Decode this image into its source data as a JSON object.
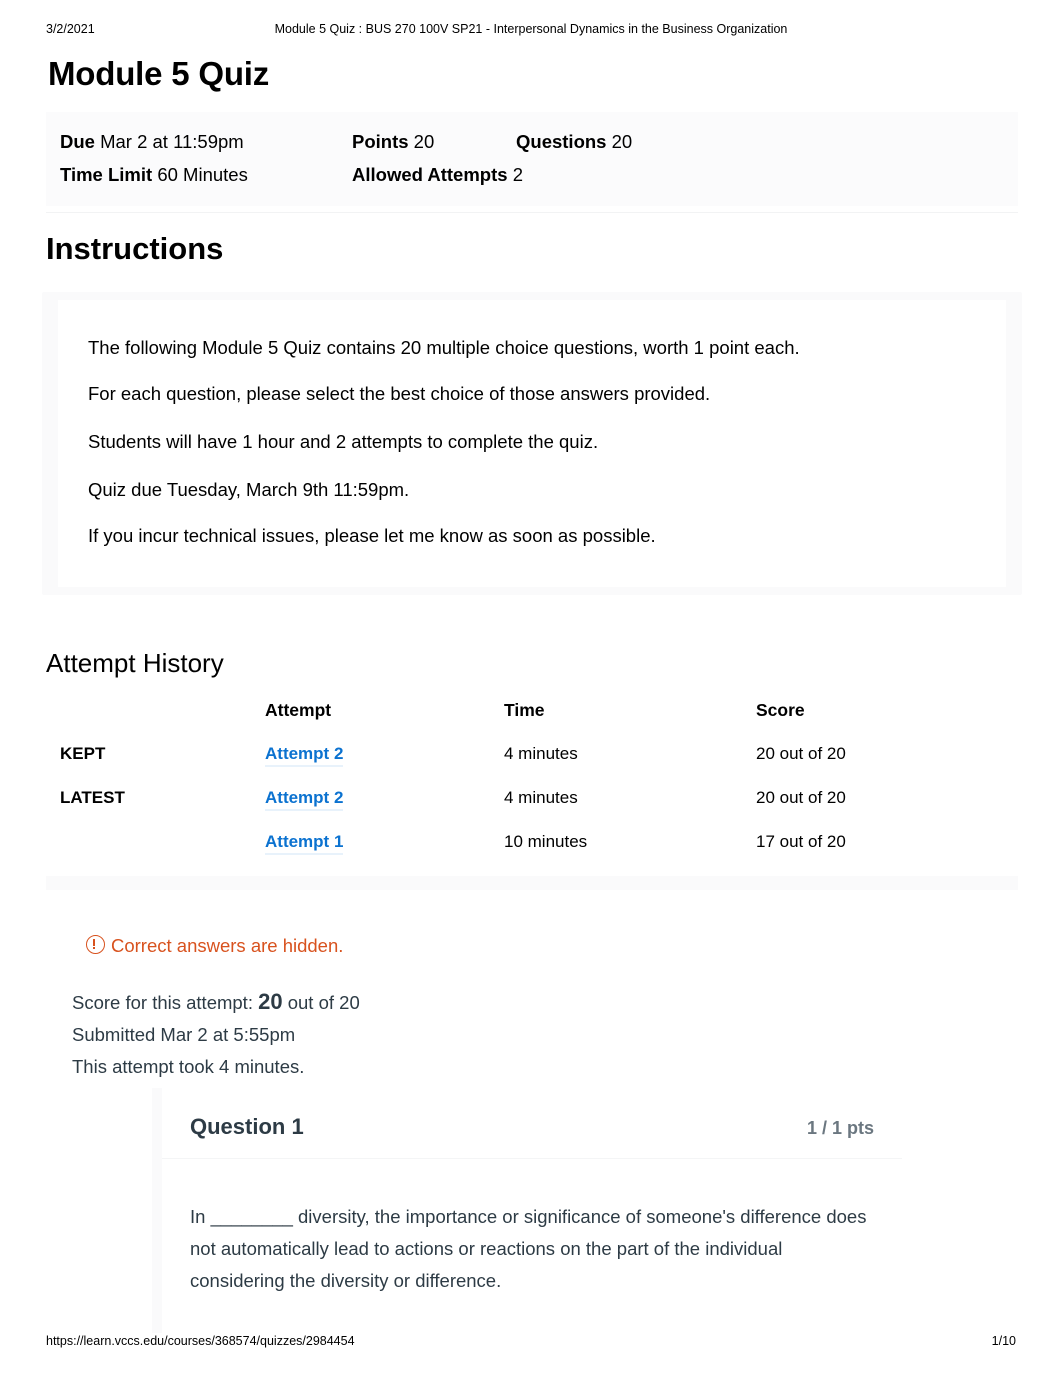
{
  "print_header": {
    "date": "3/2/2021",
    "title": "Module 5 Quiz : BUS 270 100V SP21 - Interpersonal Dynamics in the Business Organization"
  },
  "quiz": {
    "title": "Module 5 Quiz",
    "meta": {
      "due_label": "Due",
      "due_value": "Mar 2 at 11:59pm",
      "points_label": "Points",
      "points_value": "20",
      "questions_label": "Questions",
      "questions_value": "20",
      "time_limit_label": "Time Limit",
      "time_limit_value": "60 Minutes",
      "allowed_attempts_label": "Allowed Attempts",
      "allowed_attempts_value": "2"
    }
  },
  "instructions": {
    "heading": "Instructions",
    "paragraphs": [
      "The following Module 5 Quiz contains 20 multiple choice questions, worth 1 point each.",
      "For each question, please select the best choice of those answers provided.",
      "Students will have 1 hour and 2 attempts to complete the quiz.",
      "Quiz due Tuesday, March 9th  11:59pm.",
      "If you incur technical issues, please let me know as soon as possible."
    ]
  },
  "attempt_history": {
    "heading": "Attempt History",
    "columns": [
      "",
      "Attempt",
      "Time",
      "Score"
    ],
    "rows": [
      {
        "status": "KEPT",
        "attempt": "Attempt 2",
        "time": "4 minutes",
        "score": "20 out of 20"
      },
      {
        "status": "LATEST",
        "attempt": "Attempt 2",
        "time": "4 minutes",
        "score": "20 out of 20"
      },
      {
        "status": "",
        "attempt": "Attempt 1",
        "time": "10 minutes",
        "score": "17 out of 20"
      }
    ]
  },
  "notice": {
    "text": "Correct answers are hidden.",
    "icon": "warning-circle-icon",
    "color": "#d8521e"
  },
  "attempt_summary": {
    "score_prefix": "Score for this attempt:",
    "score_value": "20",
    "score_suffix": "out of 20",
    "submitted": "Submitted Mar 2 at 5:55pm",
    "duration": "This attempt took 4 minutes."
  },
  "question": {
    "title": "Question 1",
    "points": "1 / 1 pts",
    "text": "In ________ diversity, the importance or significance of someone's difference does not automatically lead to actions or reactions on the part of the individual considering the diversity or difference."
  },
  "print_footer": {
    "url": "https://learn.vccs.edu/courses/368574/quizzes/2984454",
    "page": "1/10"
  },
  "colors": {
    "link": "#0b72d0",
    "notice": "#d8521e",
    "text": "#2d3b45",
    "panel_bg": "#fafafb"
  }
}
